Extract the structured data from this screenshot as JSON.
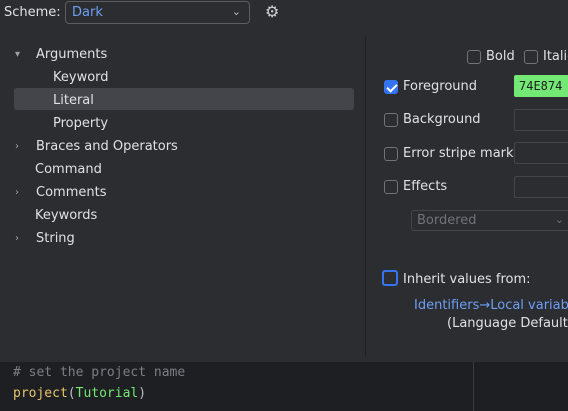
{
  "header": {
    "scheme_label": "Scheme:",
    "scheme_value": "Dark",
    "chevron_icon": "chevron-down-icon",
    "gear_icon": "gear-icon"
  },
  "tree": {
    "items": [
      {
        "label": "Arguments",
        "expanded": true,
        "arrow": "▾"
      },
      {
        "label": "Keyword"
      },
      {
        "label": "Literal",
        "selected": true
      },
      {
        "label": "Property"
      },
      {
        "label": "Braces and Operators",
        "arrow": "›"
      },
      {
        "label": "Command"
      },
      {
        "label": "Comments",
        "arrow": "›"
      },
      {
        "label": "Keywords"
      },
      {
        "label": "String",
        "arrow": "›"
      }
    ]
  },
  "options": {
    "bold": {
      "label": "Bold",
      "checked": false
    },
    "italic": {
      "label": "Italic",
      "checked": false
    },
    "foreground": {
      "label": "Foreground",
      "checked": true,
      "value": "74E874",
      "color": "#74e874"
    },
    "background": {
      "label": "Background",
      "checked": false
    },
    "error_stripe": {
      "label": "Error stripe mark",
      "checked": false
    },
    "effects": {
      "label": "Effects",
      "checked": false,
      "dropdown_value": "Bordered"
    },
    "inherit": {
      "label": "Inherit values from:",
      "checked": false
    },
    "inherit_link": "Identifiers→Local variable",
    "inherit_note": "(Language Defaults)"
  },
  "editor": {
    "line1": "# set the project name",
    "line2_fn": "project",
    "line2_open": "(",
    "line2_arg": "Tutorial",
    "line2_close": ")"
  }
}
